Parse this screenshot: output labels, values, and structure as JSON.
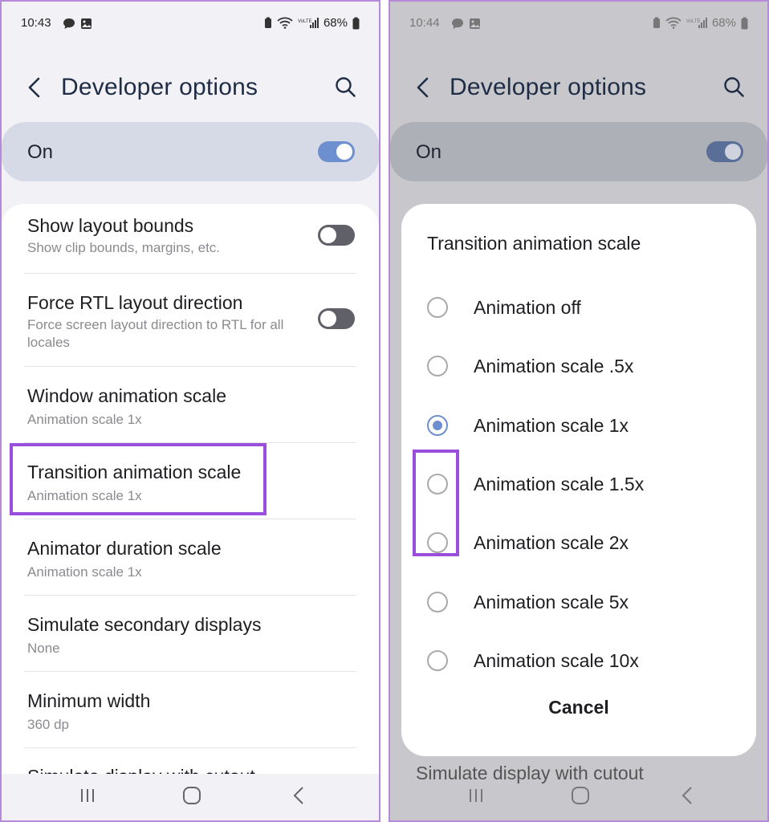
{
  "left_screen": {
    "status": {
      "time": "10:43",
      "battery": "68%"
    },
    "header": {
      "title": "Developer options"
    },
    "master_switch": {
      "label": "On",
      "state": "on"
    },
    "settings": [
      {
        "title": "Show layout bounds",
        "subtitle": "Show clip bounds, margins, etc.",
        "toggle": "off"
      },
      {
        "title": "Force RTL layout direction",
        "subtitle": "Force screen layout direction to RTL for all locales",
        "toggle": "off"
      },
      {
        "title": "Window animation scale",
        "subtitle": "Animation scale 1x"
      },
      {
        "title": "Transition animation scale",
        "subtitle": "Animation scale 1x",
        "highlighted": true
      },
      {
        "title": "Animator duration scale",
        "subtitle": "Animation scale 1x"
      },
      {
        "title": "Simulate secondary displays",
        "subtitle": "None"
      },
      {
        "title": "Minimum width",
        "subtitle": "360 dp"
      }
    ],
    "cut_off_item": "Simulate display with cutout"
  },
  "right_screen": {
    "status": {
      "time": "10:44",
      "battery": "68%"
    },
    "header": {
      "title": "Developer options"
    },
    "master_switch": {
      "label": "On",
      "state": "on"
    },
    "dialog": {
      "title": "Transition animation scale",
      "options": [
        {
          "label": "Animation off",
          "selected": false
        },
        {
          "label": "Animation scale .5x",
          "selected": false
        },
        {
          "label": "Animation scale 1x",
          "selected": true
        },
        {
          "label": "Animation scale 1.5x",
          "selected": false
        },
        {
          "label": "Animation scale 2x",
          "selected": false
        },
        {
          "label": "Animation scale 5x",
          "selected": false
        },
        {
          "label": "Animation scale 10x",
          "selected": false
        }
      ],
      "cancel_label": "Cancel"
    },
    "cut_off_item": "Simulate display with cutout"
  },
  "colors": {
    "accent": "#6d8fd0",
    "highlight": "#9a4fdc",
    "title_text": "#1e2d45"
  },
  "icons": [
    "back-arrow-icon",
    "search-icon",
    "recents-icon",
    "home-icon",
    "nav-back-icon",
    "wifi-icon",
    "signal-icon",
    "battery-icon",
    "message-icon",
    "gallery-icon"
  ]
}
